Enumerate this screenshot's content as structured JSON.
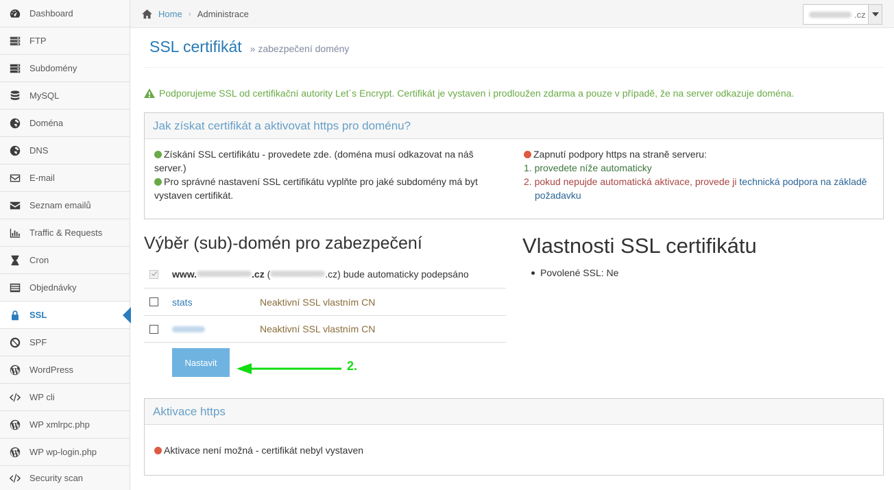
{
  "sidebar": {
    "items": [
      {
        "label": "Dashboard",
        "icon": "dashboard-icon"
      },
      {
        "label": "FTP",
        "icon": "server-icon"
      },
      {
        "label": "Subdomény",
        "icon": "server-icon"
      },
      {
        "label": "MySQL",
        "icon": "database-icon"
      },
      {
        "label": "Doména",
        "icon": "globe-icon"
      },
      {
        "label": "DNS",
        "icon": "globe-icon"
      },
      {
        "label": "E-mail",
        "icon": "envelope-outline-icon"
      },
      {
        "label": "Seznam emailů",
        "icon": "envelope-icon"
      },
      {
        "label": "Traffic & Requests",
        "icon": "bar-chart-icon"
      },
      {
        "label": "Cron",
        "icon": "hourglass-icon"
      },
      {
        "label": "Objednávky",
        "icon": "list-icon"
      },
      {
        "label": "SSL",
        "icon": "lock-icon",
        "active": true
      },
      {
        "label": "SPF",
        "icon": "ban-icon"
      },
      {
        "label": "WordPress",
        "icon": "wordpress-icon"
      },
      {
        "label": "WP cli",
        "icon": "code-icon"
      },
      {
        "label": "WP xmlrpc.php",
        "icon": "wordpress-icon"
      },
      {
        "label": "WP wp-login.php",
        "icon": "wordpress-icon"
      },
      {
        "label": "Security scan",
        "icon": "code-icon"
      }
    ]
  },
  "breadcrumb": {
    "home": "Home",
    "current": "Administrace"
  },
  "domain_select": {
    "suffix": ".cz"
  },
  "header": {
    "title": "SSL certifikát",
    "subtitle": "zabezpečení domény"
  },
  "notice": "Podporujeme SSL od certifikační autority Let´s Encrypt. Certifikát je vystaven i prodloužen zdarma a pouze v případě, že na server odkazuje doména.",
  "howto": {
    "title": "Jak získat certifikát a aktivovat https pro doménu?",
    "left_1": "Získání SSL certifikátu - provedete zde. (doména musí odkazovat na náš server.)",
    "left_2": "Pro správné nastavení SSL certifikátu vyplňte pro jaké subdomény má byt vystaven certifikát.",
    "right_head": "Zapnutí podpory https na straně serveru:",
    "right_1": "1. provedete níže automaticky",
    "right_2": "2. pokud nepujde automatická aktivace, provede ji",
    "right_2_link": "technická podpora na základě požadavku"
  },
  "selection": {
    "title": "Výběr (sub)-domén pro zabezpečení",
    "row1_prefix": "www.",
    "row1_suffix": ".cz",
    "row1_paren_suffix": ".cz)",
    "row1_text": "bude automaticky podepsáno",
    "rows": [
      {
        "name": "stats",
        "status": "Neaktivní SSL vlastním CN"
      },
      {
        "name": "",
        "status": "Neaktivní SSL vlastním CN"
      }
    ],
    "button": "Nastavit",
    "annotation": "2."
  },
  "properties": {
    "title": "Vlastnosti SSL certifikátu",
    "items": [
      "Povolené SSL: Ne"
    ]
  },
  "activation": {
    "title": "Aktivace https",
    "text": "Aktivace není možná - certifikát nebyl vystaven"
  }
}
